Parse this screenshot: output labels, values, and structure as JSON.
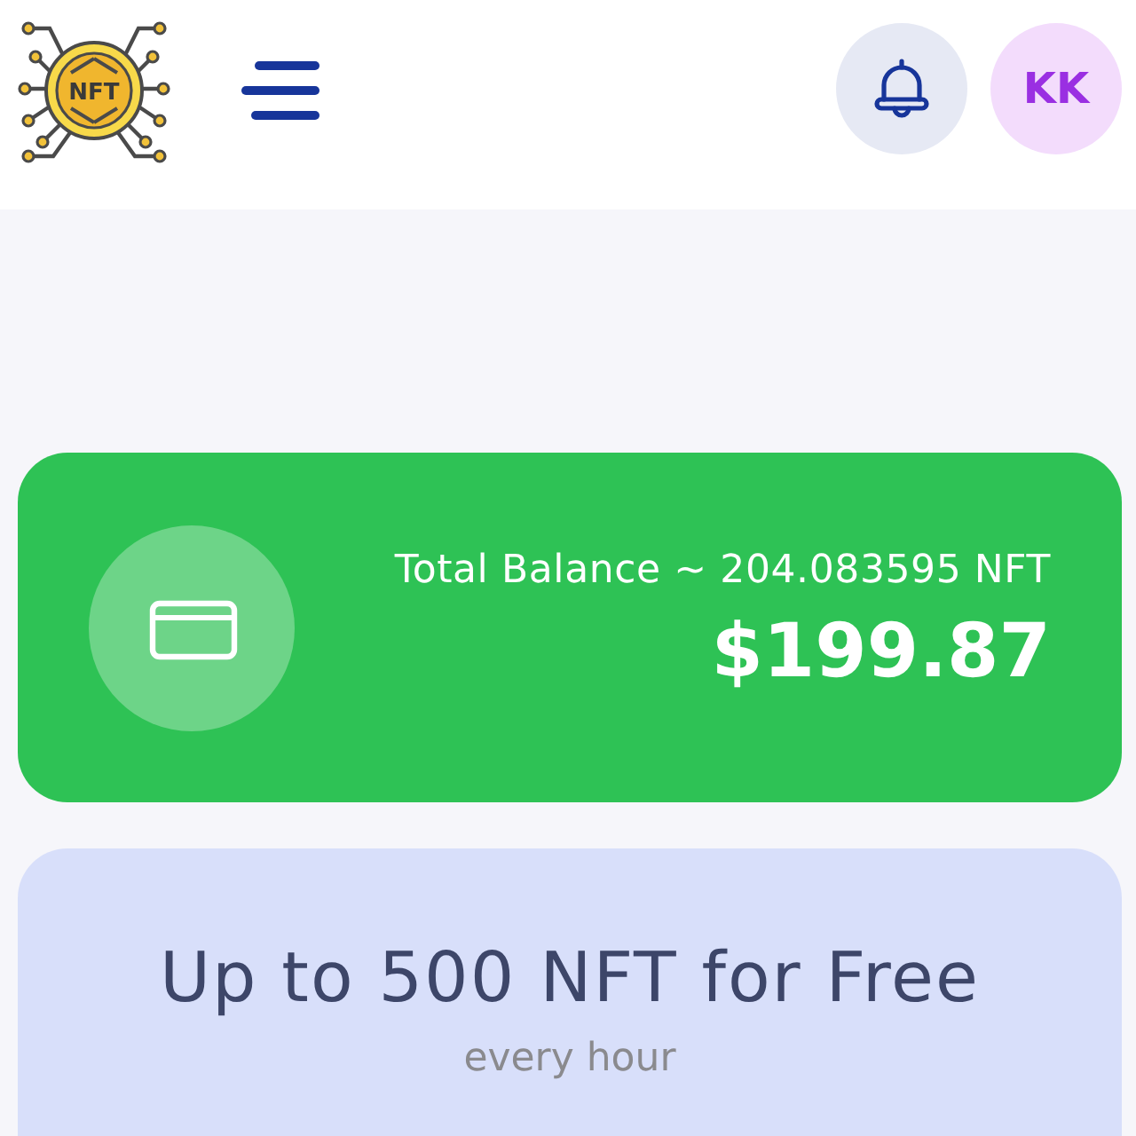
{
  "header": {
    "logo": {
      "text": "NFT"
    },
    "avatar": {
      "initials": "KK"
    }
  },
  "balance_card": {
    "label": "Total Balance ~ 204.083595 NFT",
    "amount": "$199.87"
  },
  "promo_card": {
    "title": "Up to 500 NFT for Free",
    "subtitle": "every hour"
  }
}
